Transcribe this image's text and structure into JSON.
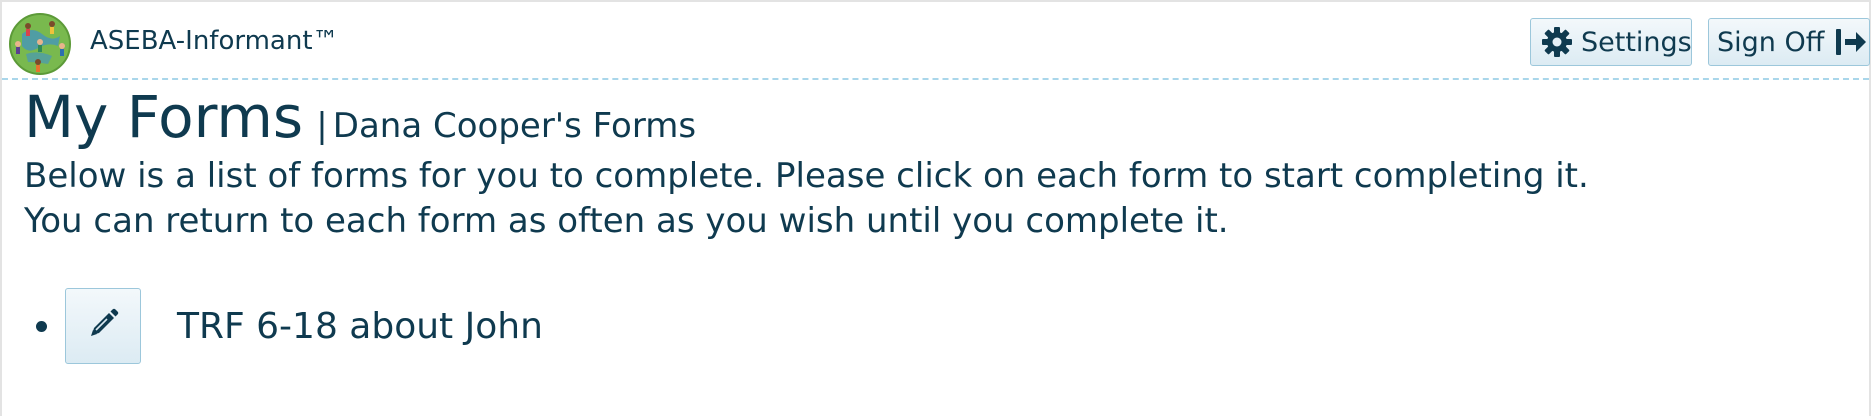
{
  "header": {
    "app_title": "ASEBA-Informant™",
    "settings_label": "Settings",
    "signoff_label": "Sign Off"
  },
  "page": {
    "title": "My Forms",
    "separator": "|",
    "subtitle": "Dana Cooper's Forms",
    "intro_line1": "Below is a list of forms for you to complete. Please click on each form to start completing it.",
    "intro_line2": "You can return to each form as often as you wish until you complete it."
  },
  "forms": [
    {
      "label": "TRF 6-18 about John",
      "icon": "pencil-icon"
    }
  ],
  "icons": {
    "logo": "globe-people-logo",
    "settings": "gear-icon",
    "signoff": "sign-out-icon"
  },
  "colors": {
    "text": "#0f3a4f",
    "button_border": "#9cc7db",
    "divider": "#a9d6ea"
  }
}
